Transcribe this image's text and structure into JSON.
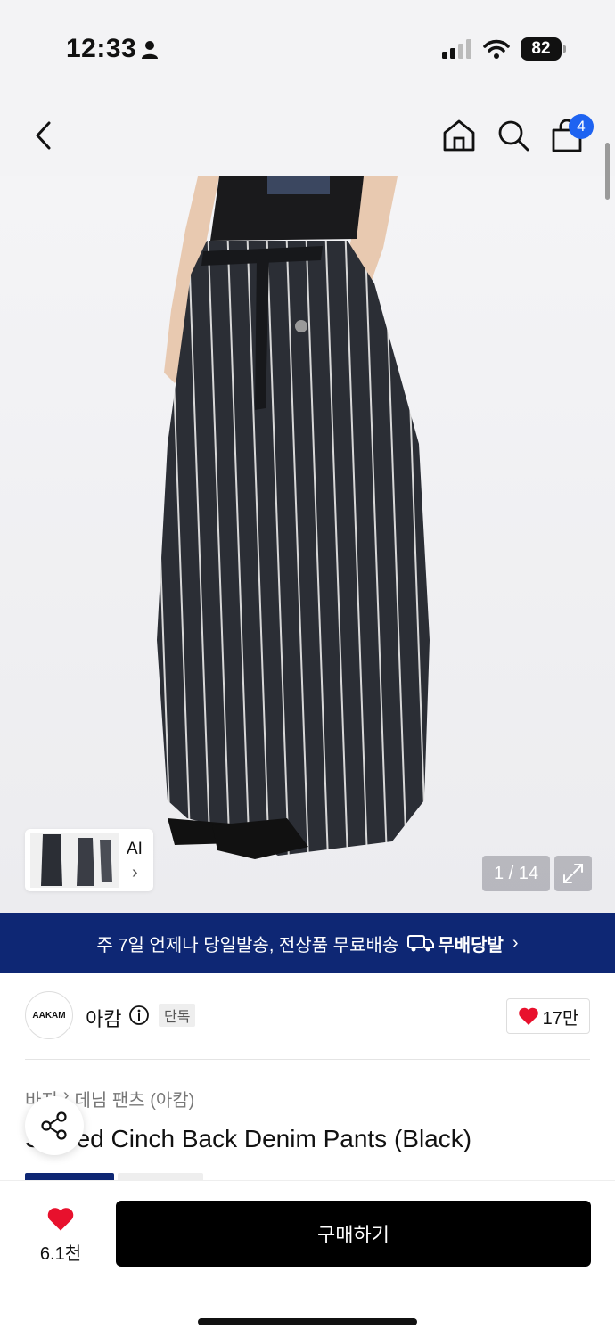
{
  "status_bar": {
    "time": "12:33",
    "battery": "82",
    "icons": [
      "person-icon",
      "cellular-signal-icon",
      "wifi-icon",
      "battery-icon"
    ]
  },
  "nav": {
    "icons": [
      "back-arrow-icon",
      "home-icon",
      "search-icon",
      "shopping-bag-icon"
    ],
    "cart_count": "4"
  },
  "gallery": {
    "thumb_label": "AI",
    "thumb_arrow": "›",
    "counter": "1 / 14"
  },
  "banner": {
    "text": "주 7일 언제나 당일발송, 전상품 무료배송",
    "logo_text": "무배당발",
    "arrow": "›"
  },
  "brand": {
    "logo_text": "AAKAM",
    "name": "아캄",
    "badge": "단독",
    "likes": "17만"
  },
  "breadcrumb": {
    "category": "바지",
    "separator": "›",
    "subcategory": "데님 팬츠 (아캄)"
  },
  "product": {
    "title": "Striped Cinch Back Denim Pants (Black)"
  },
  "bottom": {
    "wish_count": "6.1천",
    "buy_label": "구매하기"
  },
  "colors": {
    "banner_bg": "#0e2774",
    "badge_blue": "#1e63f1",
    "heart_red": "#e8112d",
    "buy_bg": "#000000"
  }
}
